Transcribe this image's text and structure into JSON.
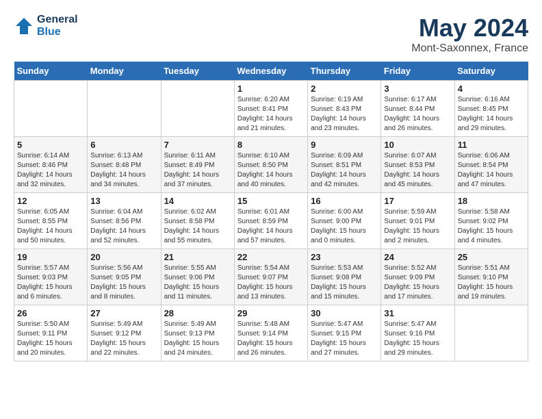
{
  "logo": {
    "line1": "General",
    "line2": "Blue"
  },
  "title": "May 2024",
  "location": "Mont-Saxonnex, France",
  "weekdays": [
    "Sunday",
    "Monday",
    "Tuesday",
    "Wednesday",
    "Thursday",
    "Friday",
    "Saturday"
  ],
  "weeks": [
    [
      {
        "day": "",
        "info": ""
      },
      {
        "day": "",
        "info": ""
      },
      {
        "day": "",
        "info": ""
      },
      {
        "day": "1",
        "info": "Sunrise: 6:20 AM\nSunset: 8:41 PM\nDaylight: 14 hours\nand 21 minutes."
      },
      {
        "day": "2",
        "info": "Sunrise: 6:19 AM\nSunset: 8:43 PM\nDaylight: 14 hours\nand 23 minutes."
      },
      {
        "day": "3",
        "info": "Sunrise: 6:17 AM\nSunset: 8:44 PM\nDaylight: 14 hours\nand 26 minutes."
      },
      {
        "day": "4",
        "info": "Sunrise: 6:16 AM\nSunset: 8:45 PM\nDaylight: 14 hours\nand 29 minutes."
      }
    ],
    [
      {
        "day": "5",
        "info": "Sunrise: 6:14 AM\nSunset: 8:46 PM\nDaylight: 14 hours\nand 32 minutes."
      },
      {
        "day": "6",
        "info": "Sunrise: 6:13 AM\nSunset: 8:48 PM\nDaylight: 14 hours\nand 34 minutes."
      },
      {
        "day": "7",
        "info": "Sunrise: 6:11 AM\nSunset: 8:49 PM\nDaylight: 14 hours\nand 37 minutes."
      },
      {
        "day": "8",
        "info": "Sunrise: 6:10 AM\nSunset: 8:50 PM\nDaylight: 14 hours\nand 40 minutes."
      },
      {
        "day": "9",
        "info": "Sunrise: 6:09 AM\nSunset: 8:51 PM\nDaylight: 14 hours\nand 42 minutes."
      },
      {
        "day": "10",
        "info": "Sunrise: 6:07 AM\nSunset: 8:53 PM\nDaylight: 14 hours\nand 45 minutes."
      },
      {
        "day": "11",
        "info": "Sunrise: 6:06 AM\nSunset: 8:54 PM\nDaylight: 14 hours\nand 47 minutes."
      }
    ],
    [
      {
        "day": "12",
        "info": "Sunrise: 6:05 AM\nSunset: 8:55 PM\nDaylight: 14 hours\nand 50 minutes."
      },
      {
        "day": "13",
        "info": "Sunrise: 6:04 AM\nSunset: 8:56 PM\nDaylight: 14 hours\nand 52 minutes."
      },
      {
        "day": "14",
        "info": "Sunrise: 6:02 AM\nSunset: 8:58 PM\nDaylight: 14 hours\nand 55 minutes."
      },
      {
        "day": "15",
        "info": "Sunrise: 6:01 AM\nSunset: 8:59 PM\nDaylight: 14 hours\nand 57 minutes."
      },
      {
        "day": "16",
        "info": "Sunrise: 6:00 AM\nSunset: 9:00 PM\nDaylight: 15 hours\nand 0 minutes."
      },
      {
        "day": "17",
        "info": "Sunrise: 5:59 AM\nSunset: 9:01 PM\nDaylight: 15 hours\nand 2 minutes."
      },
      {
        "day": "18",
        "info": "Sunrise: 5:58 AM\nSunset: 9:02 PM\nDaylight: 15 hours\nand 4 minutes."
      }
    ],
    [
      {
        "day": "19",
        "info": "Sunrise: 5:57 AM\nSunset: 9:03 PM\nDaylight: 15 hours\nand 6 minutes."
      },
      {
        "day": "20",
        "info": "Sunrise: 5:56 AM\nSunset: 9:05 PM\nDaylight: 15 hours\nand 8 minutes."
      },
      {
        "day": "21",
        "info": "Sunrise: 5:55 AM\nSunset: 9:06 PM\nDaylight: 15 hours\nand 11 minutes."
      },
      {
        "day": "22",
        "info": "Sunrise: 5:54 AM\nSunset: 9:07 PM\nDaylight: 15 hours\nand 13 minutes."
      },
      {
        "day": "23",
        "info": "Sunrise: 5:53 AM\nSunset: 9:08 PM\nDaylight: 15 hours\nand 15 minutes."
      },
      {
        "day": "24",
        "info": "Sunrise: 5:52 AM\nSunset: 9:09 PM\nDaylight: 15 hours\nand 17 minutes."
      },
      {
        "day": "25",
        "info": "Sunrise: 5:51 AM\nSunset: 9:10 PM\nDaylight: 15 hours\nand 19 minutes."
      }
    ],
    [
      {
        "day": "26",
        "info": "Sunrise: 5:50 AM\nSunset: 9:11 PM\nDaylight: 15 hours\nand 20 minutes."
      },
      {
        "day": "27",
        "info": "Sunrise: 5:49 AM\nSunset: 9:12 PM\nDaylight: 15 hours\nand 22 minutes."
      },
      {
        "day": "28",
        "info": "Sunrise: 5:49 AM\nSunset: 9:13 PM\nDaylight: 15 hours\nand 24 minutes."
      },
      {
        "day": "29",
        "info": "Sunrise: 5:48 AM\nSunset: 9:14 PM\nDaylight: 15 hours\nand 26 minutes."
      },
      {
        "day": "30",
        "info": "Sunrise: 5:47 AM\nSunset: 9:15 PM\nDaylight: 15 hours\nand 27 minutes."
      },
      {
        "day": "31",
        "info": "Sunrise: 5:47 AM\nSunset: 9:16 PM\nDaylight: 15 hours\nand 29 minutes."
      },
      {
        "day": "",
        "info": ""
      }
    ]
  ]
}
